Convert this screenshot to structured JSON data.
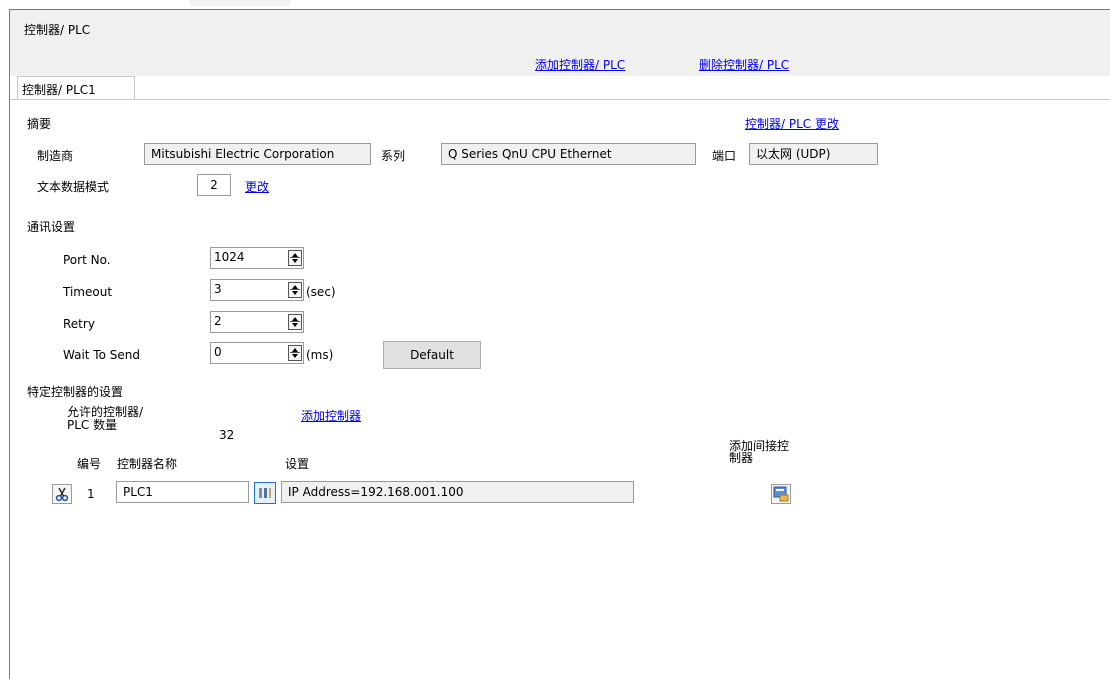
{
  "window": {
    "title": "控制器/ PLC"
  },
  "actions": {
    "add_plc": "添加控制器/ PLC",
    "delete_plc": "删除控制器/ PLC"
  },
  "tabs": [
    {
      "label": "控制器/ PLC1"
    }
  ],
  "summary": {
    "heading": "摘要",
    "change_link": "控制器/ PLC 更改",
    "manufacturer_label": "制造商",
    "manufacturer_value": "Mitsubishi Electric Corporation",
    "series_label": "系列",
    "series_value": "Q Series QnU CPU Ethernet",
    "port_label": "端口",
    "port_value": "以太网 (UDP)",
    "text_mode_label": "文本数据模式",
    "text_mode_value": "2",
    "text_mode_change": "更改"
  },
  "comm": {
    "heading": "通讯设置",
    "port_no_label": "Port No.",
    "port_no_value": "1024",
    "timeout_label": "Timeout",
    "timeout_value": "3",
    "timeout_unit": "(sec)",
    "retry_label": "Retry",
    "retry_value": "2",
    "wait_label": "Wait To Send",
    "wait_value": "0",
    "wait_unit": "(ms)",
    "default_button": "Default"
  },
  "specific": {
    "heading": "特定控制器的设置",
    "allowed_label_line1": "允许的控制器/",
    "allowed_label_line2": "PLC 数量",
    "allowed_value": "32",
    "add_controller_link": "添加控制器",
    "col_number": "编号",
    "col_name": "控制器名称",
    "col_settings": "设置",
    "col_indirect_line1": "添加间接控",
    "col_indirect_line2": "制器",
    "rows": [
      {
        "number": "1",
        "name": "PLC1",
        "settings": "IP Address=192.168.001.100"
      }
    ]
  },
  "icons": {
    "delete_row": "scissors-icon",
    "settings_row": "settings-grid-icon",
    "add_indirect": "add-indirect-controller-icon"
  }
}
